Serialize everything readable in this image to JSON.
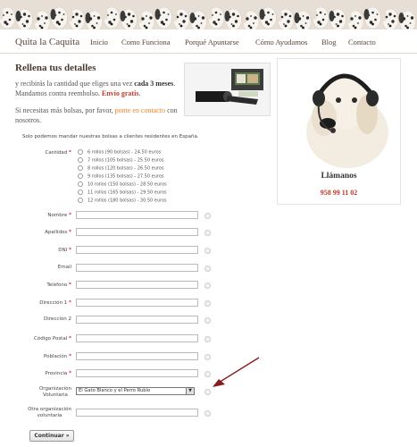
{
  "nav": {
    "brand": "Quita la Caquita",
    "items": [
      "Inicio",
      "Como Funciona",
      "Porqué Apuntarse",
      "Cómo Ayudamos",
      "Blog",
      "Contacto"
    ]
  },
  "intro": {
    "heading": "Rellena tus detalles",
    "p1_a": "y recibirás la cantidad que eliges una vez ",
    "p1_b": "cada 3 meses",
    "p1_c": ". Mandamos contra reembolso. ",
    "p1_d": "Envío gratis",
    "p1_e": ".",
    "p2_a": "Si necesitas más bolsas, por favor, ",
    "p2_b": "ponte en contacto",
    "p2_c": " con nosotros."
  },
  "callcard": {
    "title": "Llámanos",
    "phone": "958 99 11 02"
  },
  "form": {
    "notice": "Solo podemos mandar nuestras bolsas a clientes residentes en España.",
    "cantidad_label": "Cantidad",
    "cantidad_options": [
      "6 rollos (90 bolsas) - 24.50 euros",
      "7 rollos (105 bolsas) - 25.50 euros",
      "8 rollos (120 bolsas) - 26.50 euros",
      "9 rollos (135 bolsas) - 27.50 euros",
      "10 rollos (150 bolsas) - 28.50 euros",
      "11 rollos (165 bolsas) - 29.50 euros",
      "12 rollos (180 bolsas) - 30.50 euros"
    ],
    "fields": {
      "nombre": "Nombre",
      "apellidos": "Apellidos",
      "dni": "DNI",
      "email": "Email",
      "telefono": "Teléfono",
      "direccion1": "Dirección 1",
      "direccion2": "Dirección 2",
      "codigo_postal": "Código Postal",
      "poblacion": "Población",
      "provincia": "Provincia",
      "organizacion_1": "Organización",
      "organizacion_2": "Voluntaria",
      "otra_1": "Otra organización",
      "otra_2": "voluntaria"
    },
    "org_selected": "El Gato Blanco y el Perro Rubio",
    "submit": "Continuar »"
  },
  "colors": {
    "accent_red": "#c0392b",
    "link_orange": "#e8862a",
    "arrow": "#8b1a1a"
  }
}
